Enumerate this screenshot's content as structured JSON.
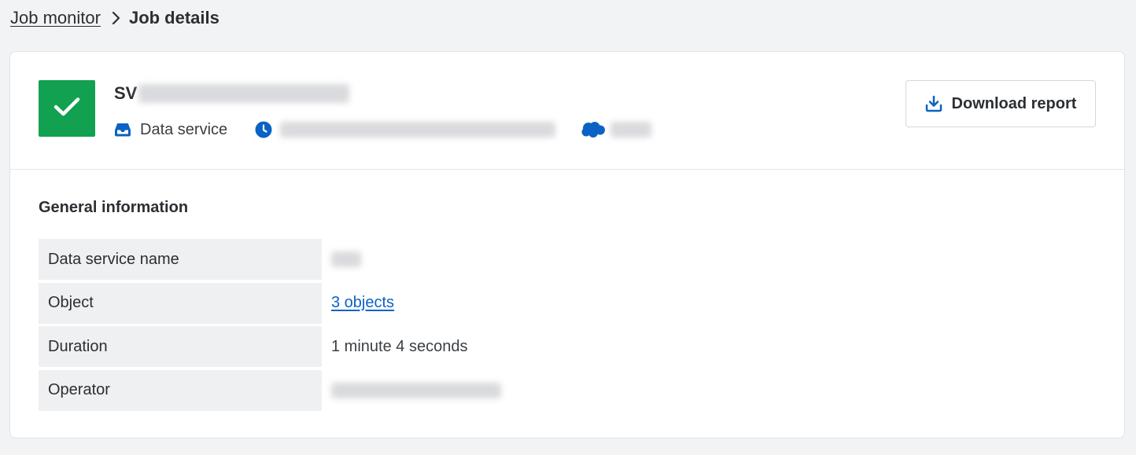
{
  "breadcrumb": {
    "parent": "Job monitor",
    "current": "Job details"
  },
  "job": {
    "title_prefix": "SV",
    "status": "success",
    "status_color": "#12a150",
    "type_label": "Data service",
    "icons": {
      "status": "check-icon",
      "type": "inbox-icon",
      "time": "clock-icon",
      "connector": "salesforce-cloud-icon"
    }
  },
  "toolbar": {
    "download_label": "Download report",
    "download_icon": "download-icon"
  },
  "general": {
    "title": "General information",
    "rows": [
      {
        "label": "Data service name",
        "value": "",
        "kind": "redacted"
      },
      {
        "label": "Object",
        "value": "3 objects",
        "kind": "link"
      },
      {
        "label": "Duration",
        "value": "1 minute 4 seconds",
        "kind": "text"
      },
      {
        "label": "Operator",
        "value": "",
        "kind": "redacted"
      }
    ]
  },
  "colors": {
    "accent": "#0b62c4",
    "success": "#12a150",
    "page_bg": "#f2f3f5"
  }
}
